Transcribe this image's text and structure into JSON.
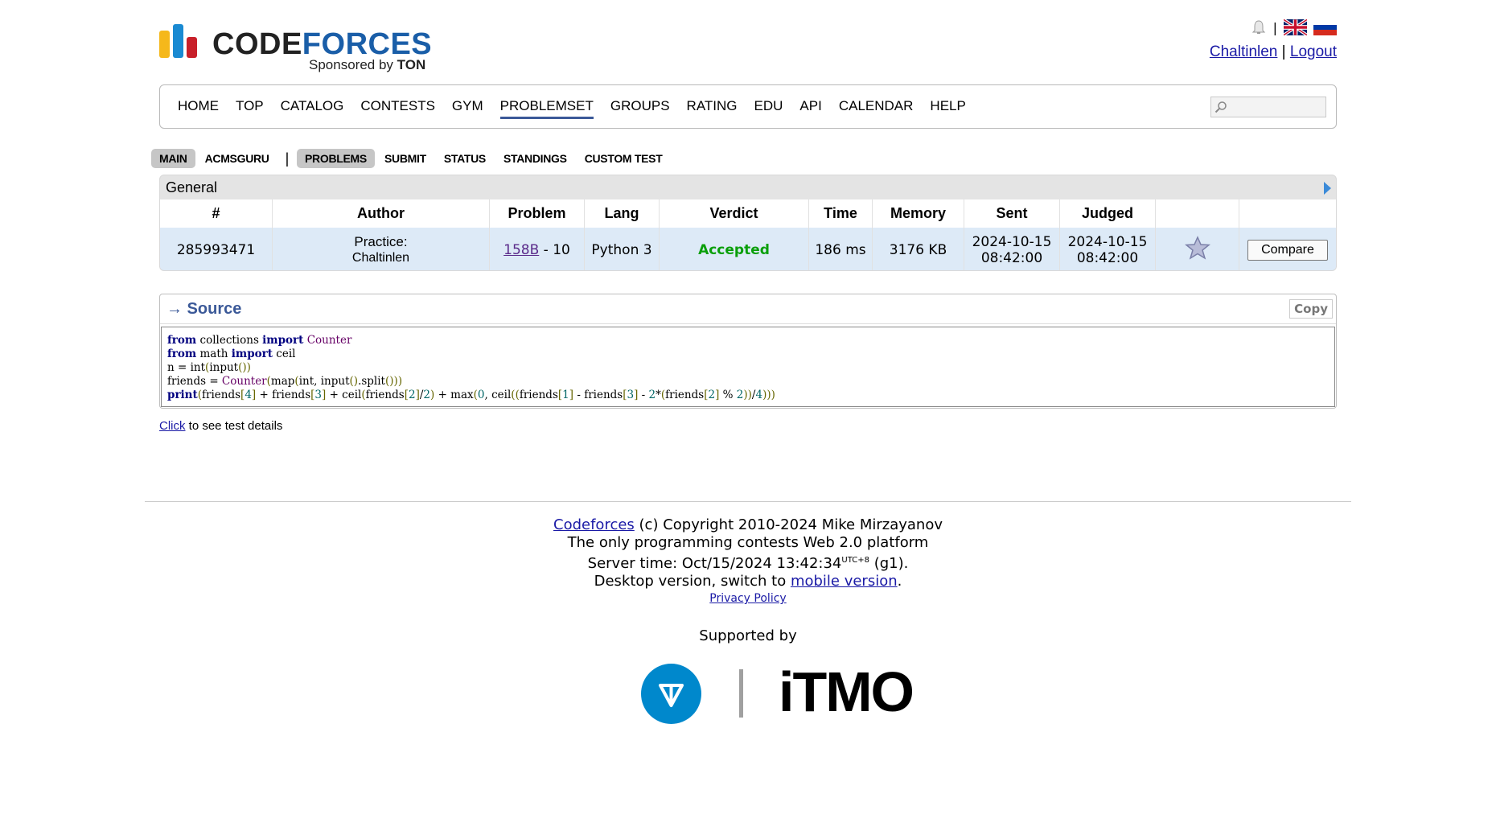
{
  "header": {
    "logo_word_code": "CODE",
    "logo_word_forces": "FORCES",
    "logo_sponsor_prefix": "Sponsored by",
    "logo_sponsor_name": "TON",
    "username": "Chaltinlen",
    "logout": "Logout",
    "separator": "|"
  },
  "nav": {
    "items": [
      "HOME",
      "TOP",
      "CATALOG",
      "CONTESTS",
      "GYM",
      "PROBLEMSET",
      "GROUPS",
      "RATING",
      "EDU",
      "API",
      "CALENDAR",
      "HELP"
    ],
    "active": "PROBLEMSET"
  },
  "subtabs": [
    "MAIN",
    "ACMSGURU",
    "PROBLEMS",
    "SUBMIT",
    "STATUS",
    "STANDINGS",
    "CUSTOM TEST"
  ],
  "status": {
    "title": "General",
    "headers": [
      "#",
      "Author",
      "Problem",
      "Lang",
      "Verdict",
      "Time",
      "Memory",
      "Sent",
      "Judged",
      "",
      ""
    ],
    "row": {
      "id": "285993471",
      "author_prefix": "Practice:",
      "author_name": "Chaltinlen",
      "problem_link": "158B",
      "problem_suffix": " - 10",
      "lang": "Python 3",
      "verdict": "Accepted",
      "time": "186 ms",
      "memory": "3176 KB",
      "sent_date": "2024-10-15",
      "sent_time": "08:42:00",
      "judged_date": "2024-10-15",
      "judged_time": "08:42:00",
      "compare_label": "Compare"
    },
    "verdict_color": "#0a9f0a"
  },
  "source": {
    "title": "→ Source",
    "copy_label": "Copy",
    "lines": [
      "from collections import Counter",
      "from math import ceil",
      "n = int(input())",
      "friends = Counter(map(int, input().split()))",
      "print(friends[4] + friends[3] + ceil(friends[2]/2) + max(0, ceil((friends[1] - friends[3] - 2*(friends[2] % 2))/4)))"
    ]
  },
  "details": {
    "click_label": "Click",
    "rest": " to see test details"
  },
  "footer": {
    "cf_link": "Codeforces",
    "copyright": " (c) Copyright 2010-2024 Mike Mirzayanov",
    "tagline": "The only programming contests Web 2.0 platform",
    "server_time_prefix": "Server time: Oct/15/2024 13:42:34",
    "server_time_tz": "UTC+8",
    "server_time_suffix": " (g1).",
    "desktop_prefix": "Desktop version, switch to ",
    "mobile_link": "mobile version",
    "desktop_suffix": ".",
    "privacy": "Privacy Policy",
    "supported_by": "Supported by",
    "itmo": "iTMO"
  },
  "colors": {
    "accent": "#3b5998",
    "row_bg": "#ddeaf7",
    "ton_blue": "#0088cc"
  }
}
